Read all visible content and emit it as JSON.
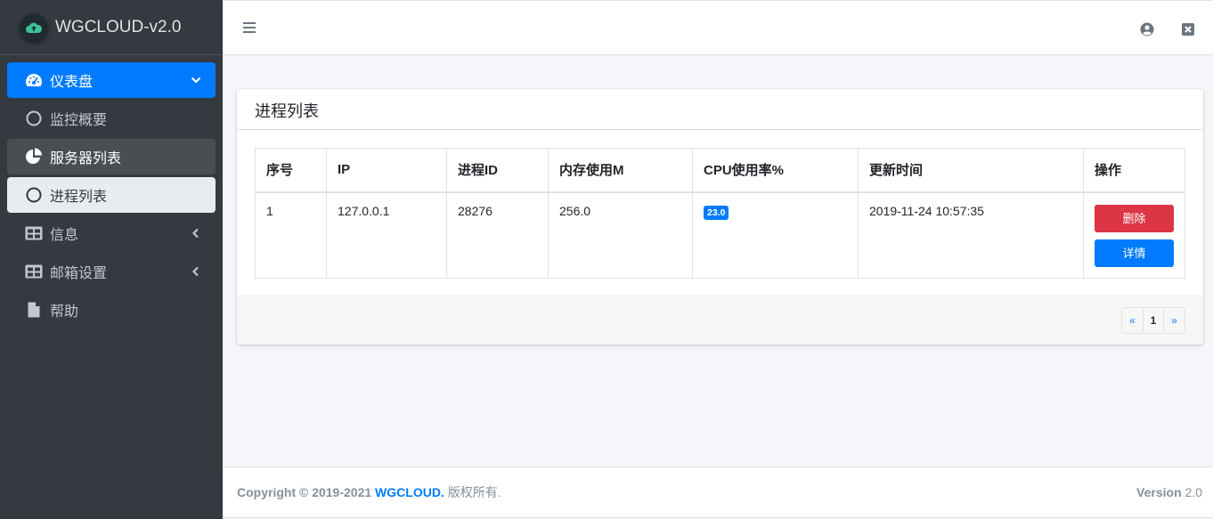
{
  "brand": {
    "name": "WGCLOUD-v2.0"
  },
  "sidebar": {
    "items": [
      {
        "label": "仪表盘",
        "icon": "dashboard-icon"
      },
      {
        "label": "监控概要",
        "icon": "circle-icon"
      },
      {
        "label": "服务器列表",
        "icon": "pie-chart-icon"
      },
      {
        "label": "进程列表",
        "icon": "circle-icon"
      },
      {
        "label": "信息",
        "icon": "table-icon"
      },
      {
        "label": "邮箱设置",
        "icon": "table-icon"
      },
      {
        "label": "帮助",
        "icon": "file-icon"
      }
    ]
  },
  "card": {
    "title": "进程列表"
  },
  "table": {
    "headers": [
      "序号",
      "IP",
      "进程ID",
      "内存使用M",
      "CPU使用率%",
      "更新时间",
      "操作"
    ],
    "rows": [
      {
        "index": "1",
        "ip": "127.0.0.1",
        "pid": "28276",
        "memory": "256.0",
        "cpu": "23.0",
        "updated": "2019-11-24 10:57:35"
      }
    ],
    "delete_label": "删除",
    "detail_label": "详情"
  },
  "pager": {
    "prev": "«",
    "current": "1",
    "next": "»"
  },
  "footer": {
    "copyright": "Copyright © 2019-2021",
    "brand": "WGCLOUD.",
    "rights": "版权所有.",
    "version_label": "Version",
    "version": "2.0"
  },
  "colors": {
    "primary": "#007bff",
    "danger": "#dc3545",
    "sidebar": "#343a40"
  }
}
